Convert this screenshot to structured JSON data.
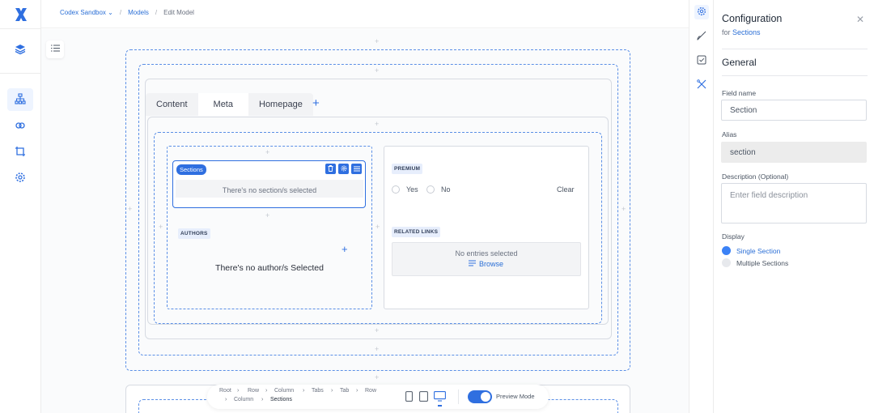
{
  "breadcrumbs": {
    "workspace": "Codex Sandbox",
    "workspace_caret": "⌄",
    "sep": "/",
    "models": "Models",
    "current": "Edit Model"
  },
  "tabs": [
    "Content",
    "Meta",
    "Homepage"
  ],
  "fields": {
    "sections": {
      "badge": "Sections",
      "empty": "There's no section/s selected"
    },
    "authors": {
      "badge": "AUTHORS",
      "empty": "There's no author/s Selected"
    },
    "premium": {
      "badge": "PREMIUM",
      "yes": "Yes",
      "no": "No",
      "clear": "Clear"
    },
    "related_links": {
      "badge": "RELATED LINKS",
      "empty": "No entries selected",
      "browse": "Browse"
    }
  },
  "bottom_bar": {
    "path_line1": [
      "Root",
      "Row",
      "Column",
      "Tabs",
      "Tab",
      "Row"
    ],
    "path_line2": [
      "Column",
      "Sections"
    ],
    "preview_label": "Preview Mode",
    "preview_on": true
  },
  "panel": {
    "title": "Configuration",
    "subtitle_prefix": "for",
    "subtitle_link": "Sections",
    "close": "✕",
    "section": "General",
    "field_name_label": "Field name",
    "field_name_value": "Section",
    "alias_label": "Alias",
    "alias_value": "section",
    "description_label": "Description (Optional)",
    "description_placeholder": "Enter field description",
    "display_label": "Display",
    "display_options": [
      "Single Section",
      "Multiple Sections"
    ],
    "display_selected": "Single Section"
  },
  "colors": {
    "accent": "#2f6fe0",
    "dashed": "#5b8fe6",
    "link": "#2b6fd6"
  }
}
